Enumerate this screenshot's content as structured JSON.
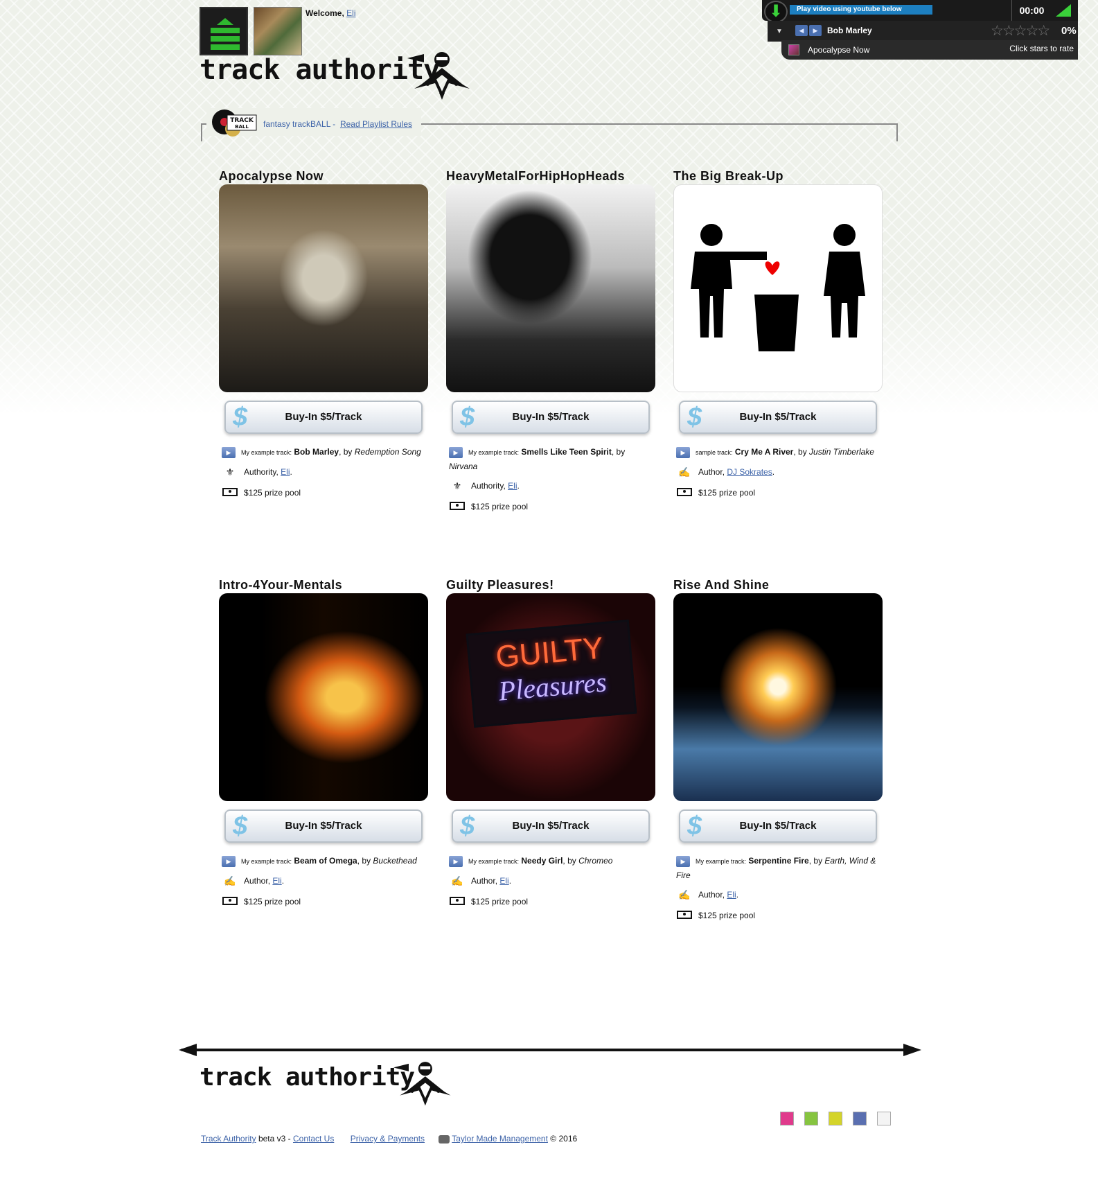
{
  "header": {
    "welcome_label": "Welcome,",
    "welcome_user": "Eli",
    "logo_text": "track authority"
  },
  "player": {
    "youtube_hint": "Play video using youtube below",
    "time": "00:00",
    "artist": "Bob Marley",
    "rating_percent": "0%",
    "song": "Apocalypse Now",
    "rate_hint": "Click stars to rate",
    "stars": "☆☆☆☆☆"
  },
  "rules": {
    "label": "fantasy trackBALL -",
    "link": "Read Playlist Rules",
    "logo_text": "fantasy TRACK BALL"
  },
  "cards": [
    {
      "title": "Apocalypse Now",
      "button": "Buy-In $5/Track",
      "sample_label": "My example track:",
      "track": "Bob Marley",
      "by": ", by",
      "artist": "Redemption Song",
      "role": "Authority,",
      "user": "Eli",
      "prize": "$125 prize pool"
    },
    {
      "title": "HeavyMetalForHipHopHeads",
      "button": "Buy-In $5/Track",
      "sample_label": "My example track:",
      "track": "Smells Like Teen Spirit",
      "by": ", by",
      "artist": "Nirvana",
      "role": "Authority,",
      "user": "Eli",
      "prize": "$125 prize pool"
    },
    {
      "title": "The Big Break-Up",
      "button": "Buy-In $5/Track",
      "sample_label": "sample track:",
      "track": "Cry Me A River",
      "by": ", by",
      "artist": "Justin Timberlake",
      "role": "Author,",
      "user": "DJ Sokrates",
      "prize": "$125 prize pool"
    },
    {
      "title": "Intro-4Your-Mentals",
      "button": "Buy-In $5/Track",
      "sample_label": "My example track:",
      "track": "Beam of Omega",
      "by": ", by",
      "artist": "Buckethead",
      "role": "Author,",
      "user": "Eli",
      "prize": "$125 prize pool"
    },
    {
      "title": "Guilty Pleasures!",
      "button": "Buy-In $5/Track",
      "sample_label": "My example track:",
      "track": "Needy Girl",
      "by": ", by",
      "artist": "Chromeo",
      "role": "Author,",
      "user": "Eli",
      "prize": "$125 prize pool",
      "sign_top": "GUILTY",
      "sign_bottom": "Pleasures"
    },
    {
      "title": "Rise And Shine",
      "button": "Buy-In $5/Track",
      "sample_label": "My example track:",
      "track": "Serpentine Fire",
      "by": ", by",
      "artist": "Earth, Wind & Fire",
      "role": "Author,",
      "user": "Eli",
      "prize": "$125 prize pool"
    }
  ],
  "footer": {
    "logo_text": "track authority",
    "site_link": "Track Authority",
    "version": "beta v3 -",
    "contact": "Contact Us",
    "privacy": "Privacy & Payments",
    "company": "Taylor Made Management",
    "copyright": "© 2016",
    "swatches": [
      "#e03a8c",
      "#86c440",
      "#d4d42a",
      "#5a6fb0",
      "#f4f4f4"
    ]
  }
}
